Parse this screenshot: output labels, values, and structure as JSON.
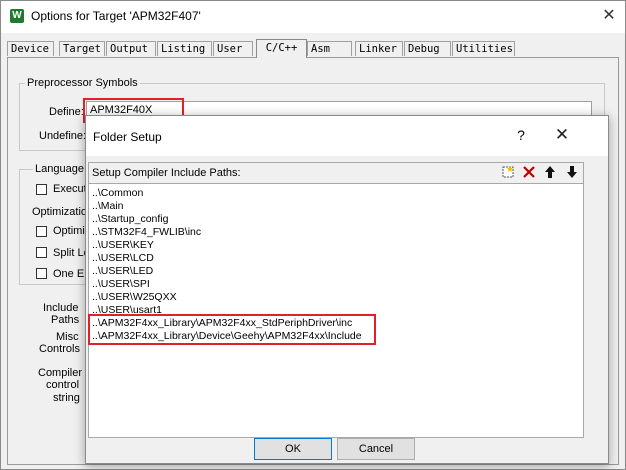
{
  "window": {
    "title": "Options for Target 'APM32F407'",
    "app_icon": "W",
    "close_glyph": "✕"
  },
  "tabs": [
    {
      "label": "Device"
    },
    {
      "label": "Target"
    },
    {
      "label": "Output"
    },
    {
      "label": "Listing"
    },
    {
      "label": "User"
    },
    {
      "label": "C/C++",
      "active": true
    },
    {
      "label": "Asm"
    },
    {
      "label": "Linker"
    },
    {
      "label": "Debug"
    },
    {
      "label": "Utilities"
    }
  ],
  "preprocessor": {
    "group_label": "Preprocessor Symbols",
    "define_label": "Define:",
    "define_value": "APM32F40X",
    "undefine_label": "Undefine:"
  },
  "left_panel": {
    "language_label": "Language",
    "execute_label": "Execut",
    "optimization_label": "Optimizatio",
    "optimize_label": "Optimiz",
    "split_label": "Split Lo",
    "one_elf_label": "One EL",
    "include_label": "Include",
    "paths_label": "Paths",
    "misc_label": "Misc",
    "controls_label": "Controls",
    "compiler_label": "Compiler",
    "control_label": "control",
    "string_label": "string"
  },
  "folder_setup": {
    "title": "Folder Setup",
    "help_glyph": "?",
    "close_glyph": "✕",
    "list_label": "Setup Compiler Include Paths:",
    "paths": [
      "..\\Common",
      "..\\Main",
      "..\\Startup_config",
      "..\\STM32F4_FWLIB\\inc",
      "..\\USER\\KEY",
      "..\\USER\\LCD",
      "..\\USER\\LED",
      "..\\USER\\SPI",
      "..\\USER\\W25QXX",
      "..\\USER\\usart1",
      "..\\APM32F4xx_Library\\APM32F4xx_StdPeriphDriver\\inc",
      "..\\APM32F4xx_Library\\Device\\Geehy\\APM32F4xx\\Include"
    ],
    "ok_label": "OK",
    "cancel_label": "Cancel"
  },
  "colors": {
    "highlight": "#e0202a",
    "accent": "#0078d7"
  }
}
